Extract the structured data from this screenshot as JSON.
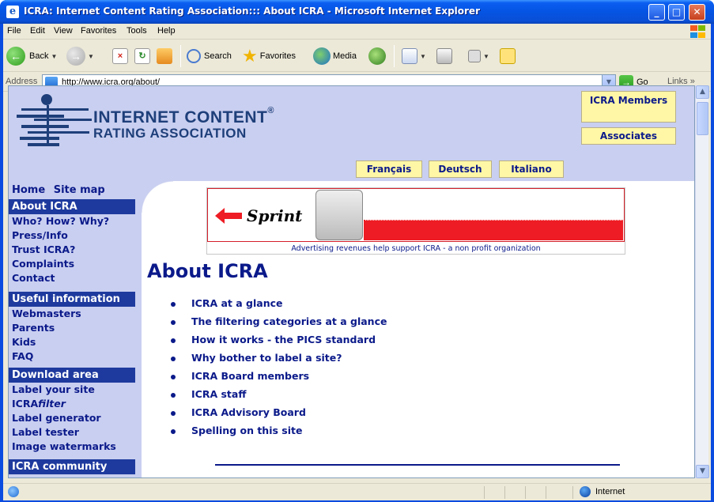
{
  "window": {
    "title": "ICRA: Internet Content Rating Association::: About ICRA - Microsoft Internet Explorer",
    "minimize": "_",
    "maximize": "□",
    "close": "✕"
  },
  "menu": [
    "File",
    "Edit",
    "View",
    "Favorites",
    "Tools",
    "Help"
  ],
  "toolbar": {
    "back": "Back",
    "search": "Search",
    "favorites": "Favorites",
    "media": "Media"
  },
  "address": {
    "label": "Address",
    "url": "http://www.icra.org/about/",
    "go": "Go",
    "links": "Links"
  },
  "header": {
    "logo_line1": "INTERNET CONTENT",
    "logo_reg": "®",
    "logo_line2": "RATING ASSOCIATION",
    "languages": [
      "Français",
      "Deutsch",
      "Italiano"
    ],
    "members": "ICRA Members",
    "associates": "Associates"
  },
  "sidebar": {
    "home": "Home",
    "sitemap": "Site map",
    "sections": [
      {
        "title": "About ICRA",
        "links": [
          "Who? How? Why?",
          "Press/Info",
          "Trust ICRA?",
          "Complaints",
          "Contact"
        ]
      },
      {
        "title": "Useful information",
        "links": [
          "Webmasters",
          "Parents",
          "Kids",
          "FAQ"
        ]
      },
      {
        "title": "Download area",
        "links": [
          "Label your site",
          "ICRA",
          "Label generator",
          "Label tester",
          "Image watermarks"
        ]
      },
      {
        "title": "ICRA community",
        "links": []
      }
    ],
    "icra_filter_italic": "filter"
  },
  "ad": {
    "brand": "Sprint",
    "caption": "Advertising revenues help support ICRA - a non profit organization"
  },
  "main": {
    "heading": "About ICRA",
    "items": [
      "ICRA at a glance",
      "The filtering categories at a glance",
      "How it works - the PICS standard",
      "Why bother to label a site?",
      "ICRA Board members",
      "ICRA staff",
      "ICRA Advisory Board",
      "Spelling on this site"
    ]
  },
  "status": {
    "zone": "Internet"
  },
  "colors": {
    "link": "#0b1a8a",
    "header_bg": "#c9cff0",
    "section_bg": "#1e3a9e",
    "button_bg": "#fff7a6",
    "sprint_red": "#ee1c24"
  }
}
